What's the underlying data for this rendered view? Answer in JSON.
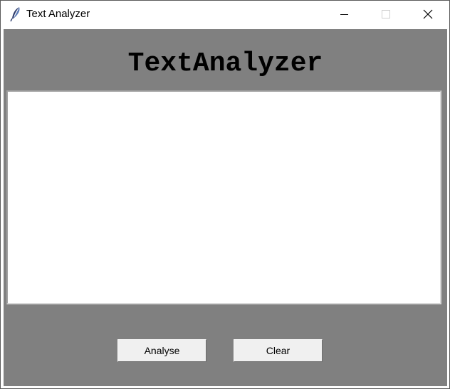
{
  "window": {
    "title": "Text Analyzer",
    "icon": "feather-icon",
    "controls": {
      "minimize": "minimize-icon",
      "maximize": "maximize-icon",
      "close": "close-icon"
    }
  },
  "main": {
    "heading": "TextAnalyzer",
    "text_input": {
      "value": "",
      "placeholder": ""
    },
    "buttons": {
      "analyse_label": "Analyse",
      "clear_label": "Clear"
    }
  },
  "colors": {
    "background": "#808080",
    "button_face": "#f0f0f0",
    "text_area": "#ffffff"
  }
}
